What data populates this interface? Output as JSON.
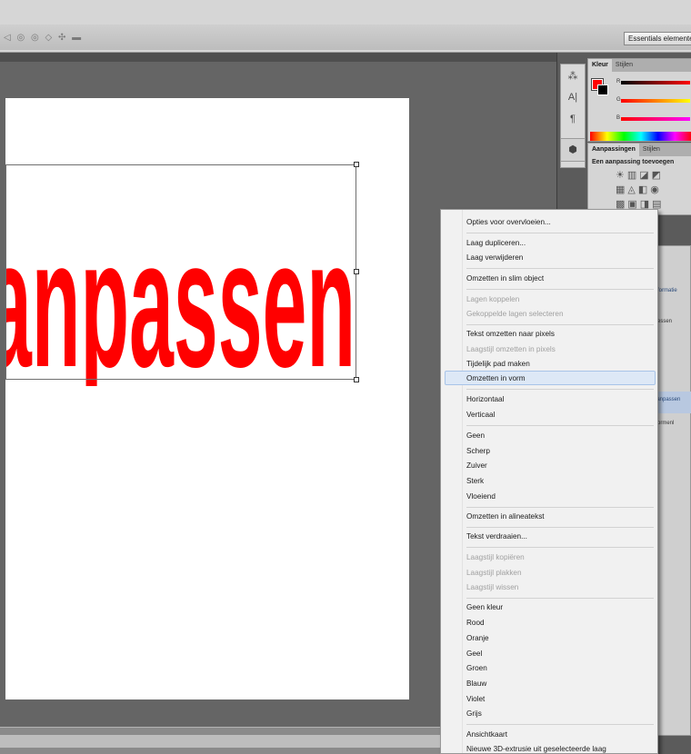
{
  "toolbar": {
    "workspace_label": "Essentials elementen"
  },
  "canvas": {
    "text_layer_content": "anpassen",
    "text_color": "#ff0000"
  },
  "color_panel": {
    "tabs": [
      "Kleur",
      "Stijlen"
    ],
    "channel_labels": [
      "R",
      "G",
      "B"
    ],
    "foreground": "#ff0000",
    "background": "#000000"
  },
  "adjustments_panel": {
    "tabs": [
      "Aanpassingen",
      "Stijlen"
    ],
    "title": "Een aanpassing toevoegen"
  },
  "layers_panel": {
    "partial_labels": [
      "formatie",
      "essen",
      "aanpassen",
      "ormenl"
    ]
  },
  "context_menu": {
    "items": [
      {
        "label": "Opties voor overvloeien...",
        "disabled": false
      },
      {
        "label": "Laag dupliceren...",
        "disabled": false
      },
      {
        "label": "Laag verwijderen",
        "disabled": false
      },
      {
        "label": "Omzetten in slim object",
        "disabled": false
      },
      {
        "label": "Lagen koppelen",
        "disabled": true
      },
      {
        "label": "Gekoppelde lagen selecteren",
        "disabled": true
      },
      {
        "label": "Tekst omzetten naar pixels",
        "disabled": false
      },
      {
        "label": "Laagstijl omzetten in pixels",
        "disabled": true
      },
      {
        "label": "Tijdelijk pad maken",
        "disabled": false
      },
      {
        "label": "Omzetten in vorm",
        "disabled": false,
        "highlighted": true
      },
      {
        "label": "Horizontaal",
        "disabled": false
      },
      {
        "label": "Verticaal",
        "disabled": false
      },
      {
        "label": "Geen",
        "disabled": false
      },
      {
        "label": "Scherp",
        "disabled": false
      },
      {
        "label": "Zuiver",
        "disabled": false
      },
      {
        "label": "Sterk",
        "disabled": false
      },
      {
        "label": "Vloeiend",
        "disabled": false
      },
      {
        "label": "Omzetten in alineatekst",
        "disabled": false
      },
      {
        "label": "Tekst verdraaien...",
        "disabled": false
      },
      {
        "label": "Laagstijl kopiëren",
        "disabled": true
      },
      {
        "label": "Laagstijl plakken",
        "disabled": true
      },
      {
        "label": "Laagstijl wissen",
        "disabled": true
      },
      {
        "label": "Geen kleur",
        "disabled": false
      },
      {
        "label": "Rood",
        "disabled": false
      },
      {
        "label": "Oranje",
        "disabled": false
      },
      {
        "label": "Geel",
        "disabled": false
      },
      {
        "label": "Groen",
        "disabled": false
      },
      {
        "label": "Blauw",
        "disabled": false
      },
      {
        "label": "Violet",
        "disabled": false
      },
      {
        "label": "Grijs",
        "disabled": false
      },
      {
        "label": "Ansichtkaart",
        "disabled": false
      },
      {
        "label": "Nieuwe 3D-extrusie uit geselecteerde laag",
        "disabled": false
      }
    ]
  }
}
